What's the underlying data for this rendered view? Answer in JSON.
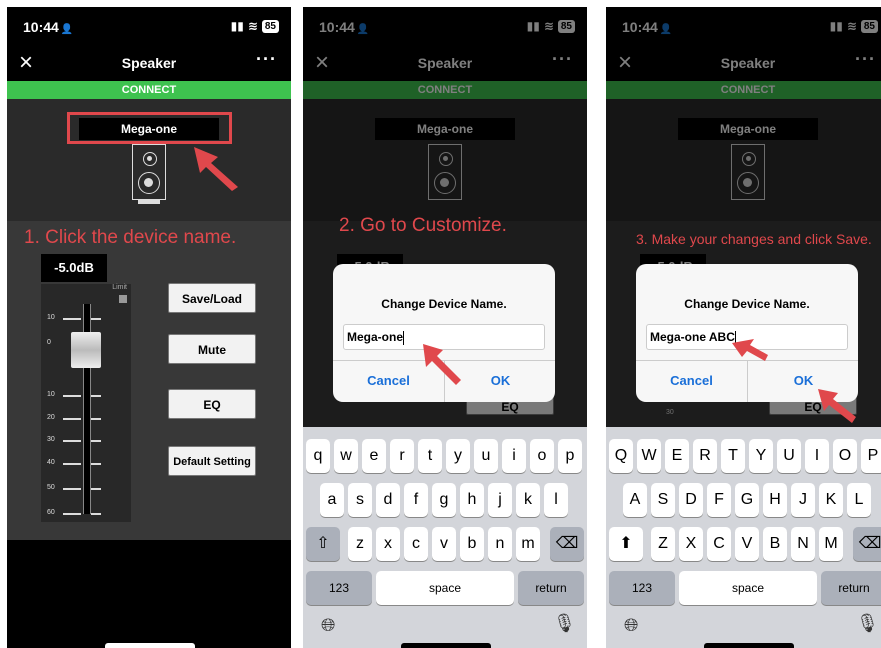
{
  "status": {
    "time": "10:44",
    "battery": "85"
  },
  "nav": {
    "title": "Speaker",
    "close_glyph": "×",
    "more_glyph": "···"
  },
  "connect": "CONNECT",
  "screens": [
    {
      "device_name": "Mega-one",
      "annotation": "1. Click the device name.",
      "db": "-5.0dB",
      "limit": "Limit",
      "buttons": [
        "Save/Load",
        "Mute",
        "EQ",
        "Default Setting"
      ],
      "fader_labels": [
        "10",
        "0",
        "10",
        "20",
        "30",
        "40",
        "50",
        "60"
      ]
    },
    {
      "device_name": "Mega-one",
      "annotation": "2. Go to Customize.",
      "db_partial": "-5.0dB",
      "dialog": {
        "title": "Change Device Name.",
        "value": "Mega-one",
        "cancel": "Cancel",
        "ok": "OK"
      },
      "bg_button": "EQ"
    },
    {
      "device_name": "Mega-one",
      "annotation": "3. Make your changes and click Save.",
      "db_partial": "-5.0dB",
      "dialog": {
        "title": "Change Device Name.",
        "value": "Mega-one ABC",
        "cancel": "Cancel",
        "ok": "OK"
      },
      "bg_button": "EQ",
      "fader_label": "30"
    }
  ],
  "keyboard_lower": {
    "row1": [
      "q",
      "w",
      "e",
      "r",
      "t",
      "y",
      "u",
      "i",
      "o",
      "p"
    ],
    "row2": [
      "a",
      "s",
      "d",
      "f",
      "g",
      "h",
      "j",
      "k",
      "l"
    ],
    "row3": [
      "z",
      "x",
      "c",
      "v",
      "b",
      "n",
      "m"
    ],
    "num": "123",
    "space": "space",
    "ret": "return"
  },
  "keyboard_upper": {
    "row1": [
      "Q",
      "W",
      "E",
      "R",
      "T",
      "Y",
      "U",
      "I",
      "O",
      "P"
    ],
    "row2": [
      "A",
      "S",
      "D",
      "F",
      "G",
      "H",
      "J",
      "K",
      "L"
    ],
    "row3": [
      "Z",
      "X",
      "C",
      "V",
      "B",
      "N",
      "M"
    ],
    "num": "123",
    "space": "space",
    "ret": "return"
  },
  "colors": {
    "accent": "#e0484c",
    "connect": "#3ec24f",
    "link": "#1a6fd8"
  },
  "icons": {
    "shift": "shift-icon",
    "delete": "delete-icon",
    "globe": "globe-icon",
    "mic": "microphone-icon"
  }
}
